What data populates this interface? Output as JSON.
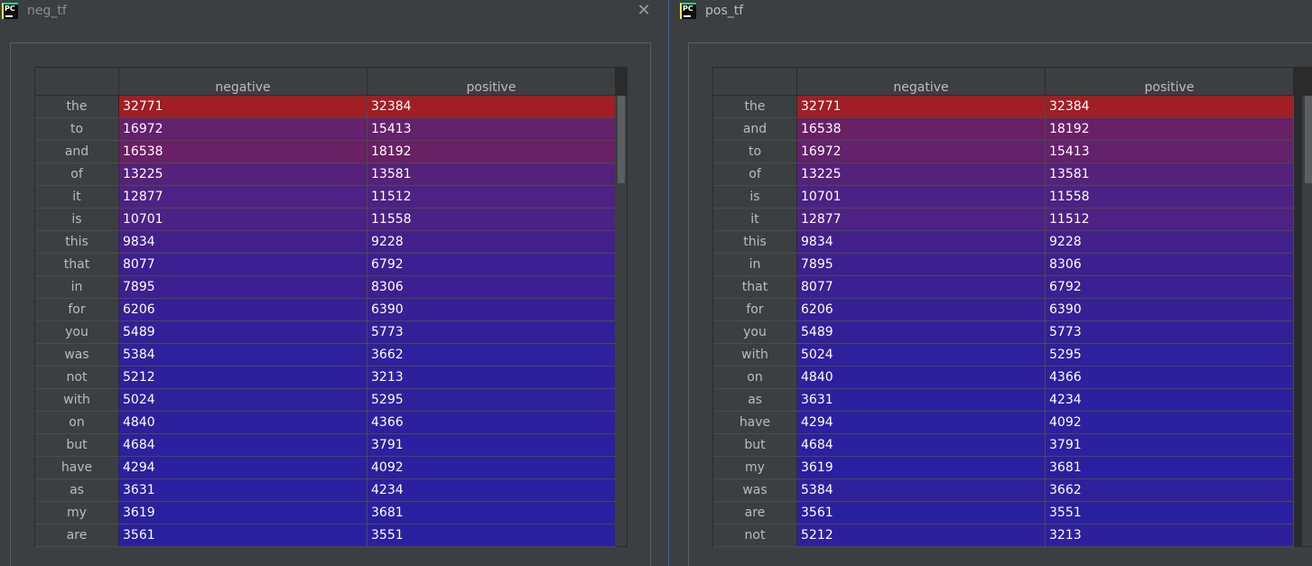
{
  "windows": [
    {
      "title": "neg_tf",
      "columns": [
        "negative",
        "positive"
      ],
      "rows": [
        {
          "word": "the",
          "negative": "32771",
          "positive": "32384",
          "color": "#a01e24"
        },
        {
          "word": "to",
          "negative": "16972",
          "positive": "15413",
          "color": "#64216c"
        },
        {
          "word": "and",
          "negative": "16538",
          "positive": "18192",
          "color": "#6a2064"
        },
        {
          "word": "of",
          "negative": "13225",
          "positive": "13581",
          "color": "#56217a"
        },
        {
          "word": "it",
          "negative": "12877",
          "positive": "11512",
          "color": "#4e2184"
        },
        {
          "word": "is",
          "negative": "10701",
          "positive": "11558",
          "color": "#4c2186"
        },
        {
          "word": "this",
          "negative": "9834",
          "positive": "9228",
          "color": "#42208c"
        },
        {
          "word": "that",
          "negative": "8077",
          "positive": "6792",
          "color": "#3a2092"
        },
        {
          "word": "in",
          "negative": "7895",
          "positive": "8306",
          "color": "#3c208f"
        },
        {
          "word": "for",
          "negative": "6206",
          "positive": "6390",
          "color": "#362096"
        },
        {
          "word": "you",
          "negative": "5489",
          "positive": "5773",
          "color": "#332099"
        },
        {
          "word": "was",
          "negative": "5384",
          "positive": "3662",
          "color": "#2f209c"
        },
        {
          "word": "not",
          "negative": "5212",
          "positive": "3213",
          "color": "#2e209d"
        },
        {
          "word": "with",
          "negative": "5024",
          "positive": "5295",
          "color": "#2f209c"
        },
        {
          "word": "on",
          "negative": "4840",
          "positive": "4366",
          "color": "#2d209e"
        },
        {
          "word": "but",
          "negative": "4684",
          "positive": "3791",
          "color": "#2b209f"
        },
        {
          "word": "have",
          "negative": "4294",
          "positive": "4092",
          "color": "#2a20a0"
        },
        {
          "word": "as",
          "negative": "3631",
          "positive": "4234",
          "color": "#2a20a0"
        },
        {
          "word": "my",
          "negative": "3619",
          "positive": "3681",
          "color": "#2920a1"
        },
        {
          "word": "are",
          "negative": "3561",
          "positive": "3551",
          "color": "#2920a1"
        }
      ]
    },
    {
      "title": "pos_tf",
      "columns": [
        "negative",
        "positive"
      ],
      "rows": [
        {
          "word": "the",
          "negative": "32771",
          "positive": "32384",
          "color": "#a01e24"
        },
        {
          "word": "and",
          "negative": "16538",
          "positive": "18192",
          "color": "#6a2064"
        },
        {
          "word": "to",
          "negative": "16972",
          "positive": "15413",
          "color": "#64216c"
        },
        {
          "word": "of",
          "negative": "13225",
          "positive": "13581",
          "color": "#56217a"
        },
        {
          "word": "is",
          "negative": "10701",
          "positive": "11558",
          "color": "#4c2186"
        },
        {
          "word": "it",
          "negative": "12877",
          "positive": "11512",
          "color": "#4e2184"
        },
        {
          "word": "this",
          "negative": "9834",
          "positive": "9228",
          "color": "#42208c"
        },
        {
          "word": "in",
          "negative": "7895",
          "positive": "8306",
          "color": "#3c208f"
        },
        {
          "word": "that",
          "negative": "8077",
          "positive": "6792",
          "color": "#3a2092"
        },
        {
          "word": "for",
          "negative": "6206",
          "positive": "6390",
          "color": "#362096"
        },
        {
          "word": "you",
          "negative": "5489",
          "positive": "5773",
          "color": "#332099"
        },
        {
          "word": "with",
          "negative": "5024",
          "positive": "5295",
          "color": "#2f209c"
        },
        {
          "word": "on",
          "negative": "4840",
          "positive": "4366",
          "color": "#2d209e"
        },
        {
          "word": "as",
          "negative": "3631",
          "positive": "4234",
          "color": "#2a20a0"
        },
        {
          "word": "have",
          "negative": "4294",
          "positive": "4092",
          "color": "#2a20a0"
        },
        {
          "word": "but",
          "negative": "4684",
          "positive": "3791",
          "color": "#2b209f"
        },
        {
          "word": "my",
          "negative": "3619",
          "positive": "3681",
          "color": "#2920a1"
        },
        {
          "word": "was",
          "negative": "5384",
          "positive": "3662",
          "color": "#2f209c"
        },
        {
          "word": "are",
          "negative": "3561",
          "positive": "3551",
          "color": "#2920a1"
        },
        {
          "word": "not",
          "negative": "5212",
          "positive": "3213",
          "color": "#2e209d"
        }
      ]
    }
  ],
  "app_icon": {
    "text": "PC"
  }
}
